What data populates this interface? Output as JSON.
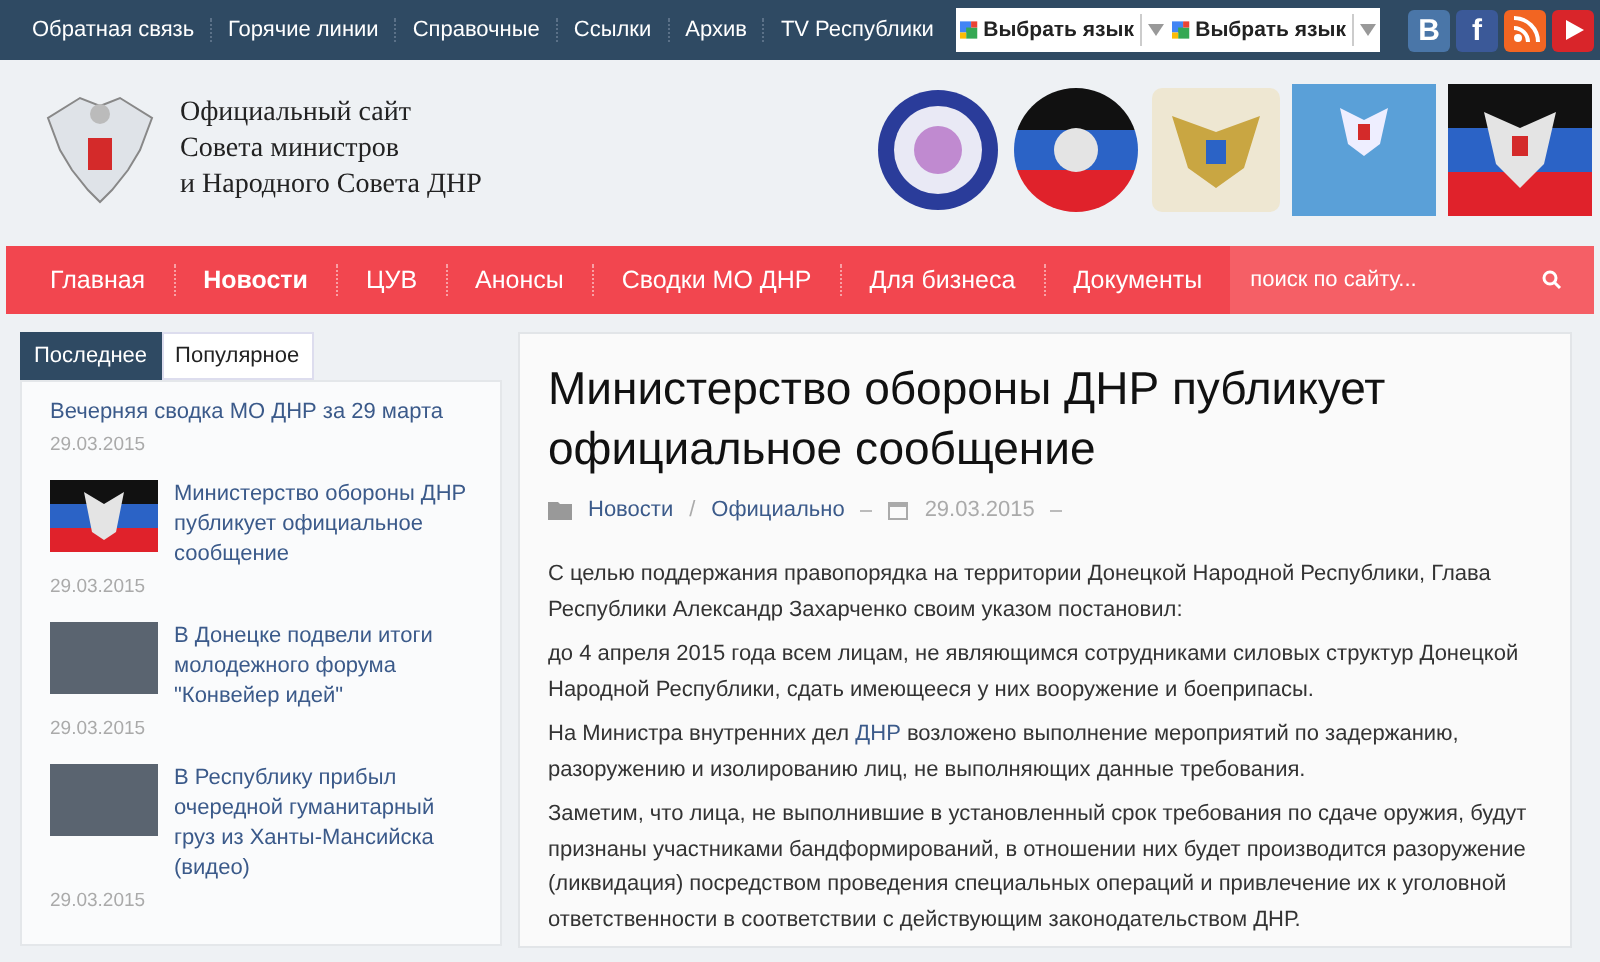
{
  "top_links": [
    "Обратная связь",
    "Горячие линии",
    "Справочные",
    "Ссылки",
    "Архив",
    "TV Республики"
  ],
  "language_selects": [
    {
      "label": "Выбрать язык"
    },
    {
      "label": "Выбрать язык"
    }
  ],
  "social": [
    {
      "kind": "vk",
      "label": "B"
    },
    {
      "kind": "facebook",
      "label": "f"
    },
    {
      "kind": "rss"
    },
    {
      "kind": "youtube"
    }
  ],
  "site_title": [
    "Официальный сайт",
    "Совета министров",
    "и Народного Совета ДНР"
  ],
  "banners": [
    {
      "kind": "circle-blue"
    },
    {
      "kind": "circle-flag"
    },
    {
      "kind": "gold"
    },
    {
      "kind": "blue"
    },
    {
      "kind": "flag"
    }
  ],
  "nav": [
    {
      "label": "Главная",
      "selected": false
    },
    {
      "label": "Новости",
      "selected": true
    },
    {
      "label": "ЦУВ",
      "selected": false
    },
    {
      "label": "Анонсы",
      "selected": false
    },
    {
      "label": "Сводки МО ДНР",
      "selected": false
    },
    {
      "label": "Для бизнеса",
      "selected": false
    },
    {
      "label": "Документы",
      "selected": false
    }
  ],
  "search": {
    "placeholder": "поиск по сайту..."
  },
  "sidebar": {
    "tabs": [
      {
        "label": "Последнее",
        "selected": true
      },
      {
        "label": "Популярное",
        "selected": false
      }
    ],
    "items": [
      {
        "kind": "text",
        "title": "Вечерняя сводка МО ДНР за 29 марта",
        "date": "29.03.2015"
      },
      {
        "kind": "flag",
        "title": "Министерство обороны ДНР публикует официальное сообщение",
        "date": "29.03.2015"
      },
      {
        "kind": "photo",
        "title": "В Донецке подвели итоги молодежного форума \"Конвейер идей\"",
        "date": "29.03.2015"
      },
      {
        "kind": "photo",
        "title": "В Республику прибыл очередной гуманитарный груз из Ханты-Мансийска (видео)",
        "date": "29.03.2015"
      }
    ]
  },
  "article": {
    "title": "Министерство обороны ДНР публикует официальное сообщение",
    "category": "Новости",
    "separator": "/",
    "subcategory": "Официально",
    "date": "29.03.2015",
    "paragraphs": [
      [
        {
          "kind": "text",
          "text": "С целью поддержания правопорядка на территории Донецкой Народной Республики, Глава Республики Александр Захарченко своим указом постановил:"
        }
      ],
      [
        {
          "kind": "text",
          "text": "до 4 апреля 2015 года всем лицам, не являющимся сотрудниками силовых структур Донецкой Народной Республики, сдать имеющееся у них вооружение и боеприпасы."
        }
      ],
      [
        {
          "kind": "text",
          "text": "На Министра внутренних дел "
        },
        {
          "kind": "link",
          "text": "ДНР"
        },
        {
          "kind": "text",
          "text": " возложено выполнение мероприятий по задержанию, разоружению и изолированию лиц, не выполняющих данные требования."
        }
      ],
      [
        {
          "kind": "text",
          "text": "Заметим, что лица, не выполнившие в установленный срок требования по сдаче оружия, будут признаны участниками бандформирований, в отношении них будет производится разоружение (ликвидация) посредством проведения специальных операций и привлечение их к уголовной ответственности в соответствии с действующим законодательством ДНР."
        }
      ]
    ]
  }
}
